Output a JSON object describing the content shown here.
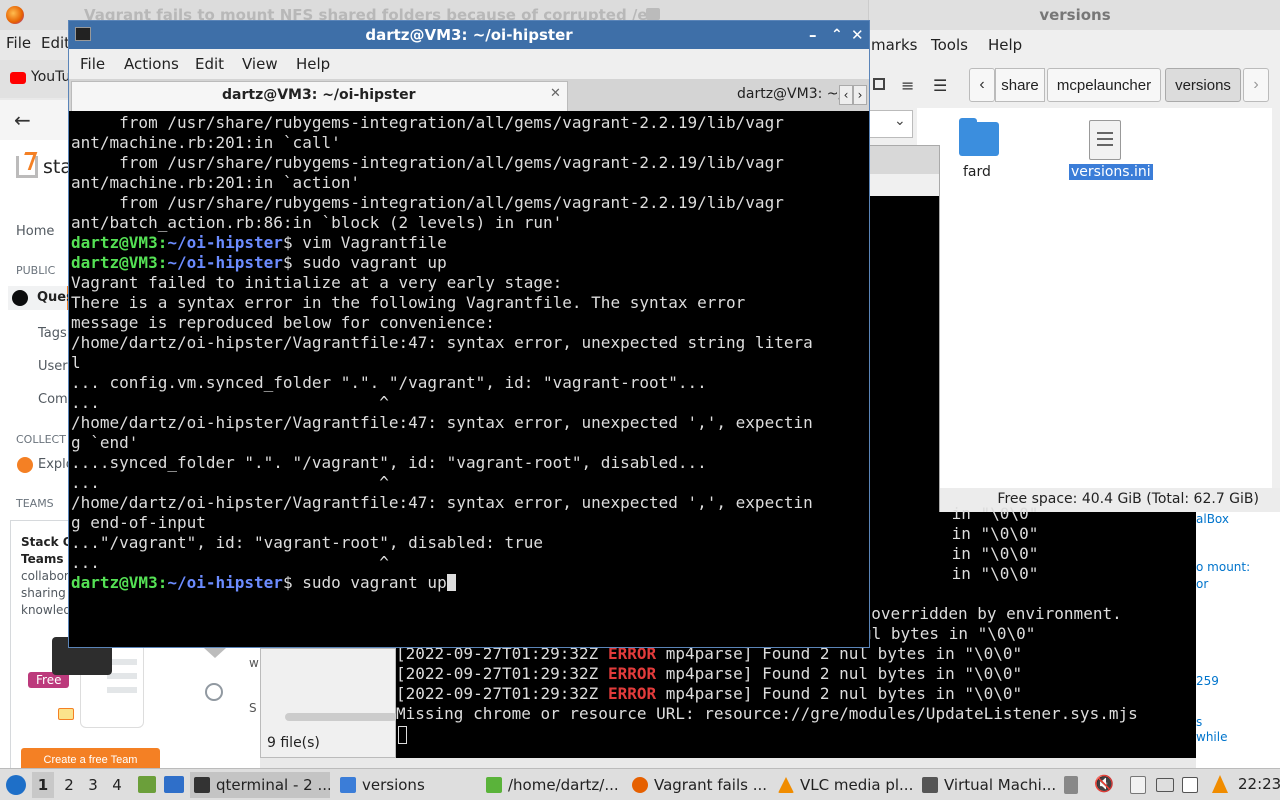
{
  "firefox": {
    "window_title": "Vagrant fails to mount NFS shared folders because of corrupted /e",
    "menu": [
      "File",
      "Edit"
    ],
    "tab_label": "YouTu",
    "so_logo_text": "sta",
    "nav": {
      "home": "Home",
      "public_header": "PUBLIC",
      "questions": "Ques",
      "tags": "Tags",
      "users": "Users",
      "companies": "Comp",
      "collectives_header": "COLLECT",
      "explore": "Explo",
      "teams_header": "TEAMS"
    },
    "teams_promo": {
      "title_line1": "Stack O",
      "title_line2": "Teams",
      "desc_line1": "collabor",
      "desc_line2": "sharing",
      "desc_line3": "knowled",
      "free_badge": "Free",
      "create_button": "Create a free Team"
    },
    "right_fragments": {
      "frag1": "alBox",
      "frag2": "o mount:",
      "frag3": "or",
      "frag4": "259",
      "frag5": "s",
      "frag6": "while"
    }
  },
  "file_manager": {
    "title": "versions",
    "menu": [
      "marks",
      "Tools",
      "Help"
    ],
    "breadcrumbs": [
      "share",
      "mcpelauncher",
      "versions"
    ],
    "items": [
      {
        "name": "fard",
        "type": "folder"
      },
      {
        "name": "versions.ini",
        "type": "file",
        "selected": true
      }
    ],
    "status": "Free space: 40.4 GiB (Total: 62.7 GiB)"
  },
  "middle_window": {
    "time_label": "--:--",
    "file_count": "9 file(s)",
    "frag_w": "w",
    "frag_s": "S"
  },
  "terminal": {
    "title": "dartz@VM3: ~/oi-hipster",
    "menu": [
      "File",
      "Actions",
      "Edit",
      "View",
      "Help"
    ],
    "tabs": [
      {
        "label": "dartz@VM3: ~/oi-hipster",
        "active": true
      },
      {
        "label": "dartz@VM3: ~/",
        "active": false
      }
    ],
    "prompt_user": "dartz@VM3",
    "prompt_path": "~/oi-hipster",
    "lines": [
      "     from /usr/share/rubygems-integration/all/gems/vagrant-2.2.19/lib/vagr",
      "ant/machine.rb:201:in `call'",
      "     from /usr/share/rubygems-integration/all/gems/vagrant-2.2.19/lib/vagr",
      "ant/machine.rb:201:in `action'",
      "     from /usr/share/rubygems-integration/all/gems/vagrant-2.2.19/lib/vagr",
      "ant/batch_action.rb:86:in `block (2 levels) in run'"
    ],
    "cmd1": "vim Vagrantfile",
    "cmd2": "sudo vagrant up",
    "output": [
      "Vagrant failed to initialize at a very early stage:",
      "",
      "There is a syntax error in the following Vagrantfile. The syntax error",
      "message is reproduced below for convenience:",
      "",
      "/home/dartz/oi-hipster/Vagrantfile:47: syntax error, unexpected string litera",
      "l",
      "... config.vm.synced_folder \".\". \"/vagrant\", id: \"vagrant-root\"...",
      "...                             ^",
      "/home/dartz/oi-hipster/Vagrantfile:47: syntax error, unexpected ',', expectin",
      "g `end'",
      "....synced_folder \".\". \"/vagrant\", id: \"vagrant-root\", disabled...",
      "...                             ^",
      "/home/dartz/oi-hipster/Vagrantfile:47: syntax error, unexpected ',', expectin",
      "g end-of-input",
      "...\"/vagrant\", id: \"vagrant-root\", disabled: true",
      "...                             ^"
    ],
    "cmd3": "sudo vagrant up"
  },
  "terminal2": {
    "partial_lines": [
      " in \"\\0\\0\"",
      " in \"\\0\\0\"",
      " in \"\\0\\0\"",
      " in \"\\0\\0\""
    ],
    "overridden": "d overridden by environment.",
    "nul_partial": "ul bytes in \"\\0\\0\"",
    "log_ts": "[2022-09-27T01:29:32Z",
    "log_level": "ERROR",
    "log_rest": "mp4parse] Found 2 nul bytes in \"\\0\\0\"",
    "missing": "Missing chrome or resource URL: resource://gre/modules/UpdateListener.sys.mjs"
  },
  "taskbar": {
    "workspaces": [
      "1",
      "2",
      "3",
      "4"
    ],
    "tasks": [
      {
        "label": "qterminal - 2 ...",
        "color": "#333333"
      },
      {
        "label": "versions",
        "color": "#3b7dd8"
      },
      {
        "label": "/home/dartz/...",
        "color": "#5ab33a"
      },
      {
        "label": "Vagrant fails ...",
        "color": "#e66000"
      },
      {
        "label": "VLC media pl...",
        "color": "#f08c00"
      },
      {
        "label": "Virtual Machi...",
        "color": "#555555"
      }
    ],
    "clock": "22:23"
  },
  "colors": {
    "terminal_titlebar": "#3e6fa8",
    "prompt_green": "#55e155",
    "prompt_blue": "#6c8cff",
    "error_red": "#e23b3b",
    "folder_blue": "#3b8ede",
    "so_orange": "#f48024"
  }
}
